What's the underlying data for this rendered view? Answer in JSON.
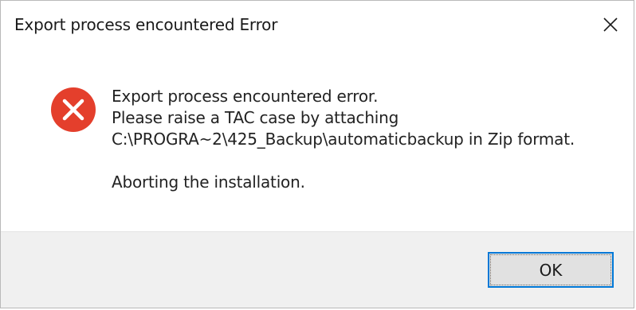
{
  "window": {
    "title": "Export process encountered Error",
    "close_icon": "close-icon"
  },
  "message": {
    "icon": "error-icon",
    "lines": [
      "Export process encountered error.",
      "Please raise a TAC case by attaching",
      "C:\\PROGRA~2\\425_Backup\\automaticbackup in Zip format."
    ],
    "footer_line": "Aborting the installation."
  },
  "buttons": {
    "ok_label": "OK"
  },
  "colors": {
    "error_red": "#e43f2c",
    "focus_blue": "#0078d7",
    "footer_bg": "#f0f0f0",
    "button_bg": "#e1e1e1"
  }
}
